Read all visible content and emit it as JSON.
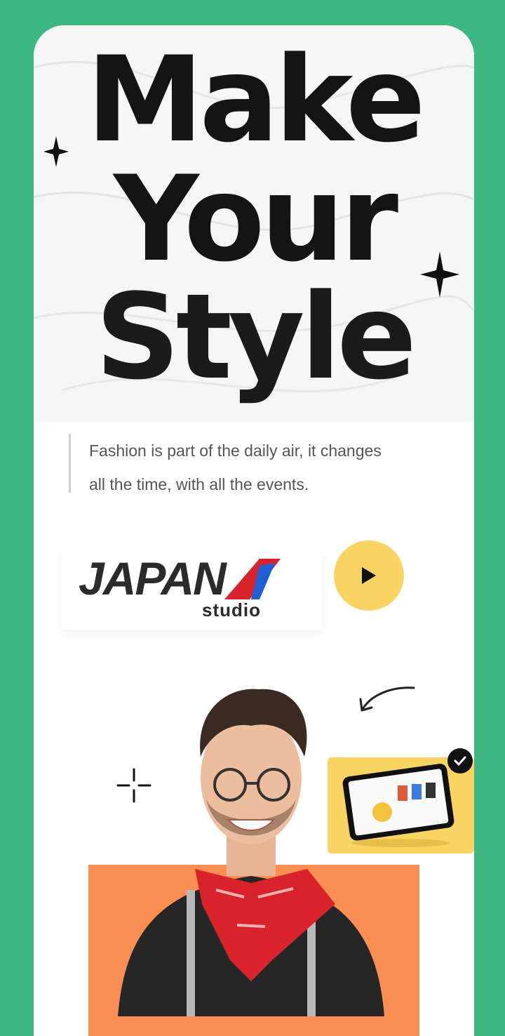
{
  "hero": {
    "line1": "Make",
    "line2": "Your",
    "line3": "Style"
  },
  "tagline": {
    "line1": "Fashion is part of the daily air, it changes",
    "line2": "all the time, with all the events."
  },
  "logo": {
    "main": "JAPAN",
    "sub": "studio"
  },
  "play_button": {
    "icon": "play-icon"
  },
  "colors": {
    "background": "#3db883",
    "card": "#ffffff",
    "accent_yellow": "#fad463",
    "accent_orange": "#f98f52",
    "scarf_red": "#d8232a"
  },
  "promo_card": {
    "icon": "check-icon"
  }
}
